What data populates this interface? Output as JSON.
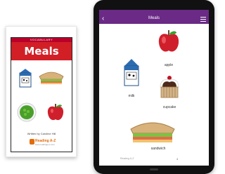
{
  "book": {
    "series_label": "VOCABULARY",
    "title": "Meals",
    "caption": "Written by Caroline Hill",
    "publisher": "Reading A-Z",
    "publisher_sub": "www.readinga-z.com"
  },
  "app": {
    "title": "Meals",
    "footer": "Reading A-Z",
    "page_number": "4",
    "items": [
      {
        "label": "apple"
      },
      {
        "label": "milk"
      },
      {
        "label": "cupcake"
      },
      {
        "label": "sandwich"
      }
    ]
  },
  "colors": {
    "tablet_appbar": "#6a2a86",
    "book_title_band": "#d21f26"
  }
}
